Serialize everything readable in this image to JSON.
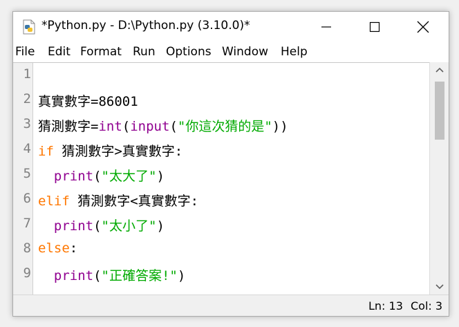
{
  "window": {
    "title": "*Python.py - D:\\Python.py (3.10.0)*",
    "icon": "python-file-icon"
  },
  "menu": [
    "File",
    "Edit",
    "Format",
    "Run",
    "Options",
    "Window",
    "Help"
  ],
  "editor": {
    "line_numbers": [
      "1",
      "2",
      "3",
      "4",
      "5",
      "6",
      "7",
      "8",
      "9"
    ],
    "lines": [
      [],
      [
        {
          "t": "真實數字=86001",
          "c": "plain"
        }
      ],
      [
        {
          "t": "猜測數字=",
          "c": "plain"
        },
        {
          "t": "int",
          "c": "bi"
        },
        {
          "t": "(",
          "c": "plain"
        },
        {
          "t": "input",
          "c": "bi"
        },
        {
          "t": "(",
          "c": "plain"
        },
        {
          "t": "\"你這次猜的是\"",
          "c": "str"
        },
        {
          "t": "))",
          "c": "plain"
        }
      ],
      [
        {
          "t": "if",
          "c": "kw"
        },
        {
          "t": " 猜測數字>真實數字:",
          "c": "plain"
        }
      ],
      [
        {
          "t": "  ",
          "c": "plain"
        },
        {
          "t": "print",
          "c": "bi"
        },
        {
          "t": "(",
          "c": "plain"
        },
        {
          "t": "\"太大了\"",
          "c": "str"
        },
        {
          "t": ")",
          "c": "plain"
        }
      ],
      [
        {
          "t": "elif",
          "c": "kw"
        },
        {
          "t": " 猜測數字<真實數字:",
          "c": "plain"
        }
      ],
      [
        {
          "t": "  ",
          "c": "plain"
        },
        {
          "t": "print",
          "c": "bi"
        },
        {
          "t": "(",
          "c": "plain"
        },
        {
          "t": "\"太小了\"",
          "c": "str"
        },
        {
          "t": ")",
          "c": "plain"
        }
      ],
      [
        {
          "t": "else",
          "c": "kw"
        },
        {
          "t": ":",
          "c": "plain"
        }
      ],
      [
        {
          "t": "  ",
          "c": "plain"
        },
        {
          "t": "print",
          "c": "bi"
        },
        {
          "t": "(",
          "c": "plain"
        },
        {
          "t": "\"正確答案!\"",
          "c": "str"
        },
        {
          "t": ")",
          "c": "plain"
        }
      ]
    ]
  },
  "status": {
    "line": "Ln: 13",
    "col": "Col: 3"
  },
  "colors": {
    "keyword": "#ff7700",
    "builtin": "#900090",
    "string": "#00aa00"
  }
}
